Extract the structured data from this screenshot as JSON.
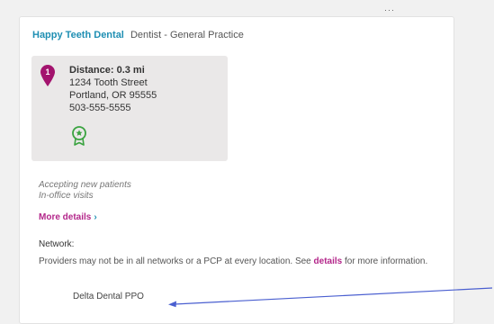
{
  "top_mark": "···",
  "provider": {
    "name": "Happy Teeth Dental",
    "specialty": "Dentist - General Practice"
  },
  "location": {
    "pin_number": "1",
    "distance": "Distance: 0.3 mi",
    "street": "1234 Tooth Street",
    "city": "Portland, OR 95555",
    "phone": "503-555-5555",
    "badge_icon": "award-ribbon-icon"
  },
  "status": {
    "accepting": "Accepting new patients",
    "in_office": "In-office visits"
  },
  "more_details": {
    "label": "More details",
    "chevron": "›"
  },
  "network": {
    "label": "Network:",
    "disclaimer_before": "Providers may not be in all networks or a PCP at every location. See ",
    "disclaimer_link": "details",
    "disclaimer_after": " for more information.",
    "plan": "Delta Dental PPO"
  },
  "colors": {
    "brand_blue": "#1f8fb3",
    "link_magenta": "#b3268a",
    "pin_magenta": "#a3136e",
    "badge_green": "#3aa340",
    "annotation_blue": "#4a5fd0"
  }
}
